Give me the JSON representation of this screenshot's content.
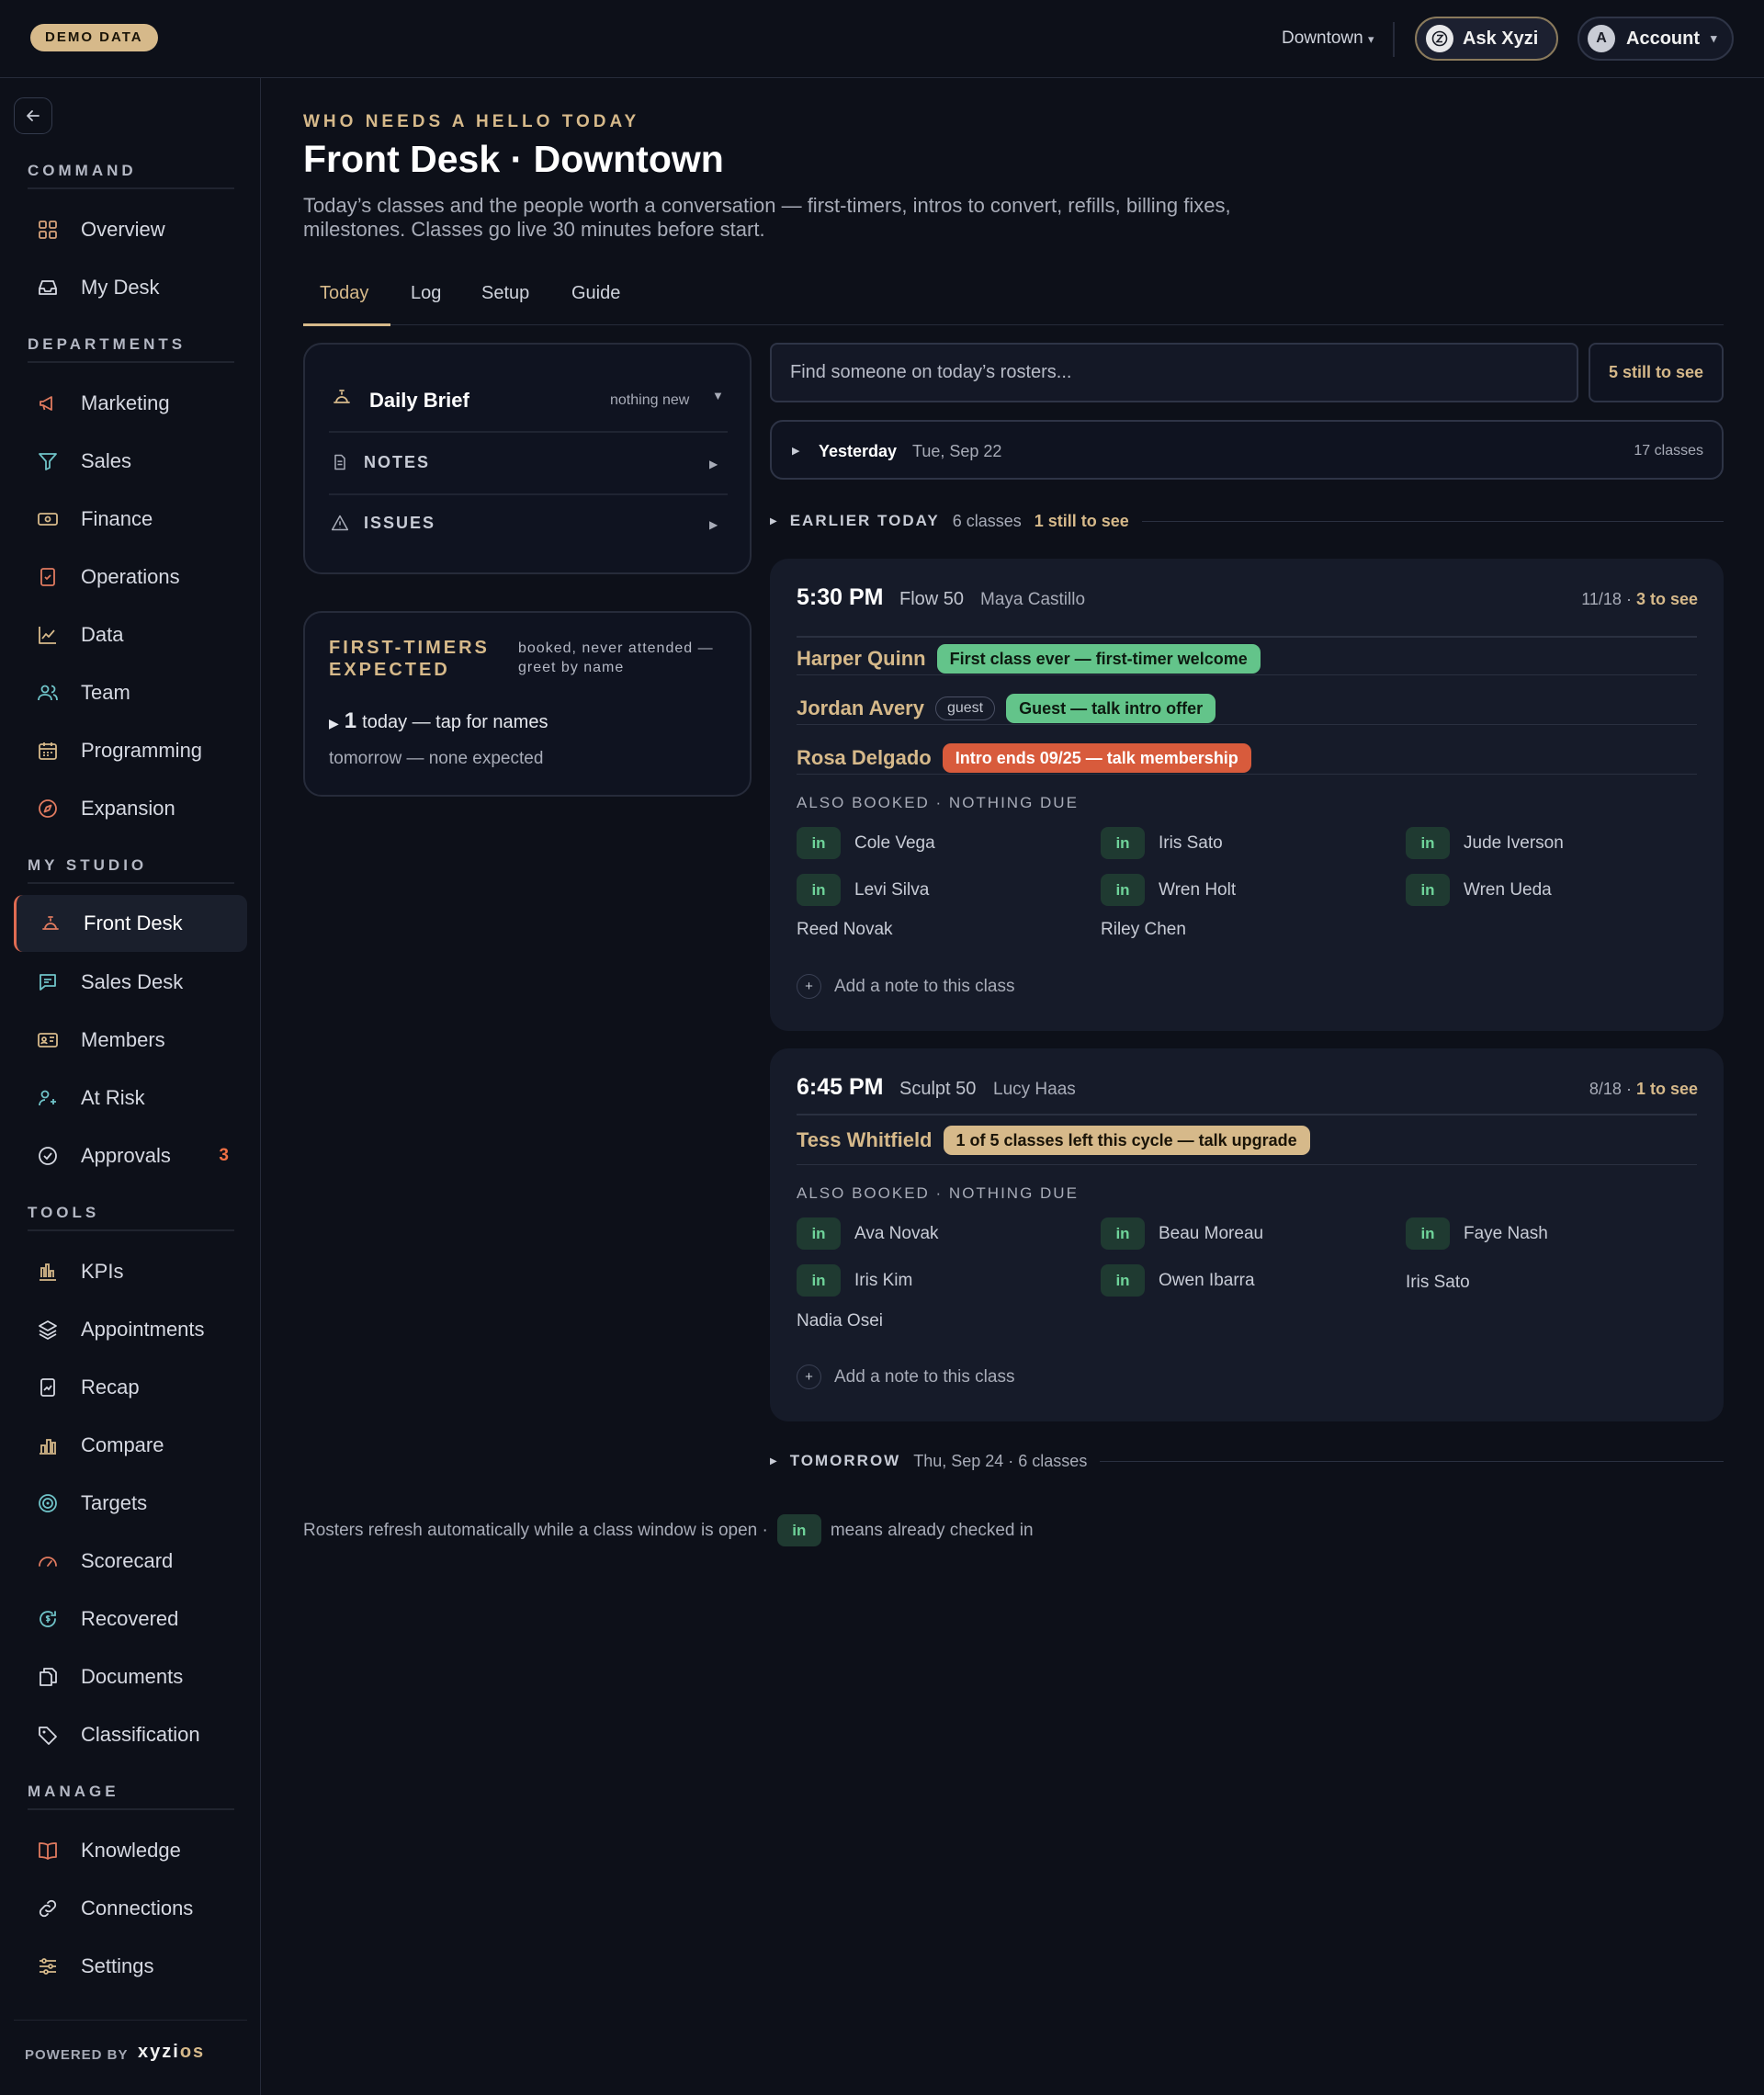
{
  "topbar": {
    "badge": "DEMO DATA",
    "location": "Downtown",
    "location_caret": "▾",
    "ask_label": "Ask Xyzi",
    "account_label": "Account",
    "account_initial": "A",
    "account_caret": "▾"
  },
  "sidebar": {
    "sections": [
      {
        "label": "COMMAND",
        "items": [
          {
            "label": "Overview",
            "icon": "grid-icon"
          },
          {
            "label": "My Desk",
            "icon": "inbox-icon"
          }
        ]
      },
      {
        "label": "DEPARTMENTS",
        "items": [
          {
            "label": "Marketing",
            "icon": "megaphone-icon"
          },
          {
            "label": "Sales",
            "icon": "filter-icon"
          },
          {
            "label": "Finance",
            "icon": "banknote-icon"
          },
          {
            "label": "Operations",
            "icon": "clipboard-check-icon"
          },
          {
            "label": "Data",
            "icon": "line-chart-icon"
          },
          {
            "label": "Team",
            "icon": "users-icon"
          },
          {
            "label": "Programming",
            "icon": "calendar-icon"
          },
          {
            "label": "Expansion",
            "icon": "compass-icon"
          }
        ]
      },
      {
        "label": "MY STUDIO",
        "items": [
          {
            "label": "Front Desk",
            "icon": "bell-icon",
            "active": true
          },
          {
            "label": "Sales Desk",
            "icon": "message-icon"
          },
          {
            "label": "Members",
            "icon": "id-card-icon"
          },
          {
            "label": "At Risk",
            "icon": "user-plus-icon"
          },
          {
            "label": "Approvals",
            "icon": "check-circle-icon",
            "badge": "3"
          }
        ]
      },
      {
        "label": "TOOLS",
        "items": [
          {
            "label": "KPIs",
            "icon": "bar-chart-icon"
          },
          {
            "label": "Appointments",
            "icon": "layers-icon"
          },
          {
            "label": "Recap",
            "icon": "file-chart-icon"
          },
          {
            "label": "Compare",
            "icon": "columns-chart-icon"
          },
          {
            "label": "Targets",
            "icon": "target-icon"
          },
          {
            "label": "Scorecard",
            "icon": "gauge-icon"
          },
          {
            "label": "Recovered",
            "icon": "refresh-dollar-icon"
          },
          {
            "label": "Documents",
            "icon": "documents-icon"
          },
          {
            "label": "Classification",
            "icon": "tag-icon"
          }
        ]
      },
      {
        "label": "MANAGE",
        "items": [
          {
            "label": "Knowledge",
            "icon": "book-icon"
          },
          {
            "label": "Connections",
            "icon": "link-icon"
          },
          {
            "label": "Settings",
            "icon": "sliders-icon"
          }
        ]
      }
    ],
    "powered_by": "POWERED BY",
    "powered_logo_a": "xyzi",
    "powered_logo_b": "os"
  },
  "header": {
    "eyebrow": "WHO NEEDS A HELLO TODAY",
    "title": "Front Desk · Downtown",
    "subtitle": "Today’s classes and the people worth a conversation — first-timers, intros to convert, refills, billing fixes, milestones. Classes go live 30 minutes before start."
  },
  "tabs": [
    "Today",
    "Log",
    "Setup",
    "Guide"
  ],
  "brief": {
    "title": "Daily Brief",
    "status": "nothing new",
    "notes_label": "NOTES",
    "issues_label": "ISSUES"
  },
  "first_timers": {
    "title": "FIRST-TIMERS EXPECTED",
    "note": "booked, never attended — greet by name",
    "today_count": "1",
    "today_text": "today — tap for names",
    "tomorrow_text": "tomorrow — none expected"
  },
  "search": {
    "placeholder": "Find someone on today’s rosters...",
    "still_label": "5 still to see"
  },
  "yesterday": {
    "label": "Yesterday",
    "date": "Tue, Sep 22",
    "count": "17 classes"
  },
  "earlier": {
    "label": "EARLIER TODAY",
    "count": "6 classes",
    "still": "1 still to see"
  },
  "tomorrow": {
    "label": "TOMORROW",
    "meta": "Thu, Sep 24 · 6 classes"
  },
  "classes": [
    {
      "time": "5:30 PM",
      "name": "Flow 50",
      "coach": "Maya Castillo",
      "capacity": "11/18 ·",
      "to_see": "3 to see",
      "people": [
        {
          "name": "Harper Quinn",
          "tag": "First class ever — first-timer welcome",
          "tag_color": "green"
        },
        {
          "name": "Jordan Avery",
          "guest": "guest",
          "tag": "Guest — talk intro offer",
          "tag_color": "green"
        },
        {
          "name": "Rosa Delgado",
          "tag": "Intro ends 09/25 — talk membership",
          "tag_color": "red"
        }
      ],
      "also_label": "ALSO BOOKED · NOTHING DUE",
      "members": [
        {
          "name": "Cole Vega",
          "in": "in"
        },
        {
          "name": "Iris Sato",
          "in": "in"
        },
        {
          "name": "Jude Iverson",
          "in": "in"
        },
        {
          "name": "Levi Silva",
          "in": "in"
        },
        {
          "name": "Wren Holt",
          "in": "in"
        },
        {
          "name": "Wren Ueda",
          "in": "in"
        },
        {
          "name": "Reed Novak"
        },
        {
          "name": "Riley Chen"
        }
      ],
      "add_note": "Add a note to this class"
    },
    {
      "time": "6:45 PM",
      "name": "Sculpt 50",
      "coach": "Lucy Haas",
      "capacity": "8/18 ·",
      "to_see": "1 to see",
      "people": [
        {
          "name": "Tess Whitfield",
          "tag": "1 of 5 classes left this cycle — talk upgrade",
          "tag_color": "gold"
        }
      ],
      "also_label": "ALSO BOOKED · NOTHING DUE",
      "members": [
        {
          "name": "Ava Novak",
          "in": "in"
        },
        {
          "name": "Beau Moreau",
          "in": "in"
        },
        {
          "name": "Faye Nash",
          "in": "in"
        },
        {
          "name": "Iris Kim",
          "in": "in"
        },
        {
          "name": "Owen Ibarra",
          "in": "in"
        },
        {
          "name": "Iris Sato"
        },
        {
          "name": "Nadia Osei"
        }
      ],
      "add_note": "Add a note to this class"
    }
  ],
  "footer": {
    "text_a": "Rosters refresh automatically while a class window is open ·",
    "pill": "in",
    "text_b": "means already checked in"
  },
  "colors": {
    "accent": "#d6b98a",
    "active": "#e06b52",
    "green_tag": "#63c48a",
    "red_tag": "#d85b3c",
    "badge": "#f07044",
    "background": "#0d1019",
    "card": "#161b29"
  }
}
